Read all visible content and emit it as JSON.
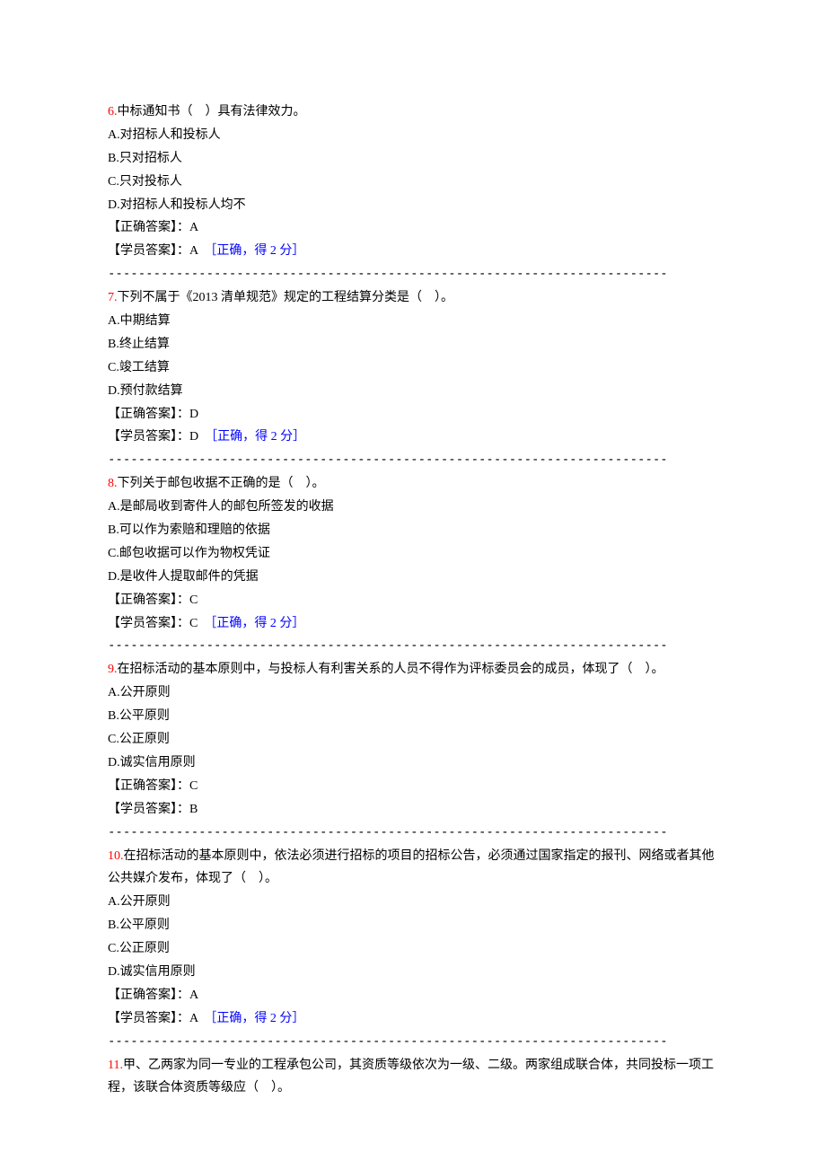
{
  "separator": "--------------------------------------------------------------------------",
  "labels": {
    "correct_answer": "【正确答案】：",
    "student_answer": "【学员答案】：",
    "correct_mark": "［正确，得 2 分］"
  },
  "questions": [
    {
      "num": "6.",
      "stem": "中标通知书（　）具有法律效力。",
      "options": [
        "A.对招标人和投标人",
        "B.只对招标人",
        "C.只对投标人",
        "D.对招标人和投标人均不"
      ],
      "correct": "A",
      "student": "A",
      "is_correct": true
    },
    {
      "num": "7.",
      "stem": "下列不属于《2013 清单规范》规定的工程结算分类是（　）。",
      "options": [
        "A.中期结算",
        "B.终止结算",
        "C.竣工结算",
        "D.预付款结算"
      ],
      "correct": "D",
      "student": "D",
      "is_correct": true
    },
    {
      "num": "8.",
      "stem": "下列关于邮包收据不正确的是（　）。",
      "options": [
        "A.是邮局收到寄件人的邮包所签发的收据",
        "B.可以作为索赔和理赔的依据",
        "C.邮包收据可以作为物权凭证",
        "D.是收件人提取邮件的凭据"
      ],
      "correct": "C",
      "student": "C",
      "is_correct": true
    },
    {
      "num": "9.",
      "stem": "在招标活动的基本原则中，与投标人有利害关系的人员不得作为评标委员会的成员，体现了（　）。",
      "options": [
        "A.公开原则",
        "B.公平原则",
        "C.公正原则",
        "D.诚实信用原则"
      ],
      "correct": "C",
      "student": "B",
      "is_correct": false
    },
    {
      "num": "10.",
      "stem": "在招标活动的基本原则中，依法必须进行招标的项目的招标公告，必须通过国家指定的报刊、网络或者其他公共媒介发布，体现了（　）。",
      "options": [
        "A.公开原则",
        "B.公平原则",
        "C.公正原则",
        "D.诚实信用原则"
      ],
      "correct": "A",
      "student": "A",
      "is_correct": true
    },
    {
      "num": "11.",
      "stem": "甲、乙两家为同一专业的工程承包公司，其资质等级依次为一级、二级。两家组成联合体，共同投标一项工程，该联合体资质等级应（　）。",
      "options": [],
      "correct": "",
      "student": "",
      "is_correct": false,
      "partial": true
    }
  ]
}
